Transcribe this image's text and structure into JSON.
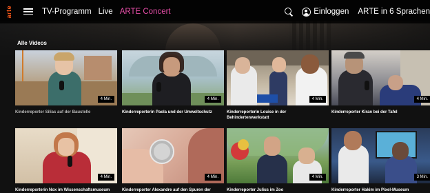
{
  "header": {
    "logo": "arte",
    "nav": [
      "TV-Programm",
      "Live",
      "ARTE Concert"
    ],
    "login_label": "Einloggen",
    "language_label": "ARTE in 6 Sprachen"
  },
  "section_title": "Alle Videos",
  "videos": [
    {
      "title": "Kinderreporter Silias auf der Baustelle",
      "duration": "4 Min."
    },
    {
      "title": "Kinderreporterin Paola und der Umweltschutz",
      "duration": "4 Min."
    },
    {
      "title": "Kinderreporterin Louise in der Behindertenwerkstatt",
      "duration": "4 Min."
    },
    {
      "title": "Kinderreporter Kiran bei der Tafel",
      "duration": "4 Min."
    },
    {
      "title": "Kinderreporterin Nox im Wissenschaftsmuseum",
      "duration": "4 Min."
    },
    {
      "title": "Kinderreporter Alexandre auf den Spuren der",
      "duration": "4 Min."
    },
    {
      "title": "Kinderreporter Julius im Zoo",
      "duration": "4 Min."
    },
    {
      "title": "Kinderreporter Hakim im Pixel-Museum",
      "duration": "3 Min."
    }
  ],
  "colors": {
    "accent": "#e64ea8",
    "logo": "#ff5b1a",
    "background": "#111111"
  }
}
